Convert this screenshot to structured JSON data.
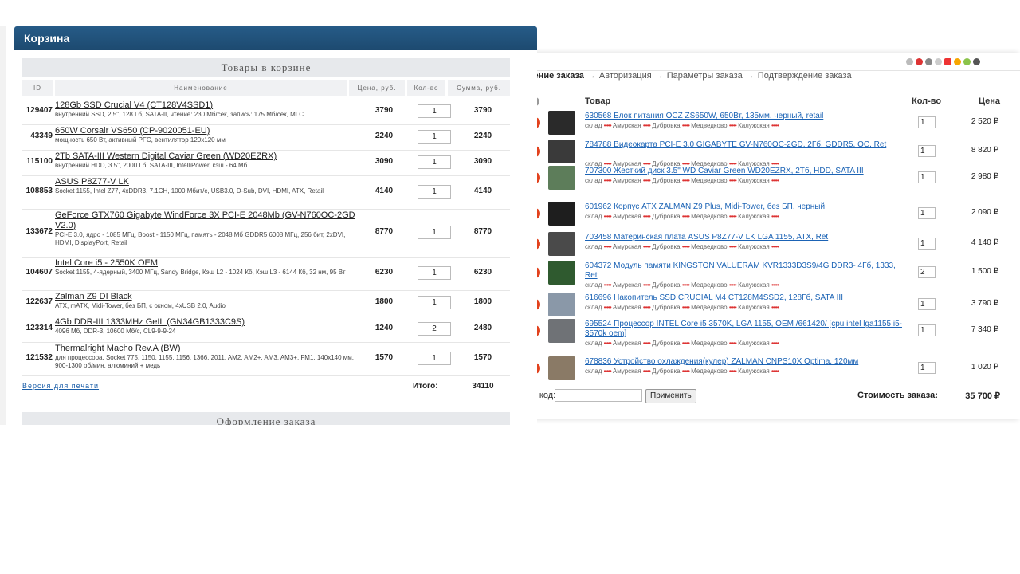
{
  "left_window": {
    "title": "Корзина",
    "section_title": "Товары в корзине",
    "columns": {
      "id": "ID",
      "name": "Наименование",
      "price": "Цена, руб.",
      "qty": "Кол-во",
      "sum": "Сумма, руб."
    },
    "rows": [
      {
        "id": "129407",
        "name": "128Gb SSD Crucial V4 (CT128V4SSD1)",
        "desc": "внутренний SSD, 2.5\", 128 Гб, SATA-II, чтение: 230 Мб/сек, запись: 175 Мб/сек, MLC",
        "price": "3790",
        "qty": "1",
        "sum": "3790"
      },
      {
        "id": "43349",
        "name": "650W Corsair VS650 (CP-9020051-EU)",
        "desc": "мощность 650 Вт, активный PFC, вентилятор 120x120 мм",
        "price": "2240",
        "qty": "1",
        "sum": "2240"
      },
      {
        "id": "115100",
        "name": "2Tb SATA-III Western Digital Caviar Green (WD20EZRX)",
        "desc": "внутренний HDD, 3.5\", 2000 Гб, SATA-III, IntelliPower, кэш - 64 Мб",
        "price": "3090",
        "qty": "1",
        "sum": "3090"
      },
      {
        "id": "108853",
        "name": "ASUS P8Z77-V LK",
        "desc": "Socket 1155, Intel Z77, 4xDDR3, 7.1CH, 1000 Мбит/с, USB3.0, D-Sub, DVI, HDMI, ATX, Retail",
        "price": "4140",
        "qty": "1",
        "sum": "4140"
      },
      {
        "id": "133672",
        "name": "GeForce GTX760 Gigabyte WindForce 3X PCI-E 2048Mb (GV-N760OC-2GD V2.0)",
        "desc": "PCI-E 3.0, ядро - 1085 МГц, Boost - 1150 МГц, память - 2048 Мб GDDR5 6008 МГц, 256 бит, 2xDVI, HDMI, DisplayPort, Retail",
        "price": "8770",
        "qty": "1",
        "sum": "8770"
      },
      {
        "id": "104607",
        "name": "Intel Core i5 - 2550K OEM",
        "desc": "Socket 1155, 4-ядерный, 3400 МГц, Sandy Bridge, Кэш L2 - 1024 Кб, Кэш L3 - 6144 Кб, 32 нм, 95 Вт",
        "price": "6230",
        "qty": "1",
        "sum": "6230"
      },
      {
        "id": "122637",
        "name": "Zalman Z9 DI Black",
        "desc": "ATX, mATX, Midi-Tower, без БП, с окном, 4xUSB 2.0, Audio",
        "price": "1800",
        "qty": "1",
        "sum": "1800"
      },
      {
        "id": "123314",
        "name": "4Gb DDR-III 1333MHz GeIL (GN34GB1333C9S)",
        "desc": "4096 Мб, DDR-3, 10600 Мб/с, CL9-9-9-24",
        "price": "1240",
        "qty": "2",
        "sum": "2480"
      },
      {
        "id": "121532",
        "name": "Thermalright Macho Rev.A (BW)",
        "desc": "для процессора, Socket 775, 1150, 1155, 1156, 1366, 2011, AM2, AM2+, AM3, AM3+, FM1, 140x140 мм, 900-1300 об/мин, алюминий + медь",
        "price": "1570",
        "qty": "1",
        "sum": "1570"
      }
    ],
    "print_link": "Версия для печати",
    "total_label": "Итого:",
    "total_value": "34110",
    "order_section": "Оформление заказа"
  },
  "right_window": {
    "breadcrumbs": [
      "Уточнение заказа",
      "Авторизация",
      "Параметры заказа",
      "Подтверждение заказа"
    ],
    "columns": {
      "product": "Товар",
      "qty": "Кол-во",
      "price": "Цена"
    },
    "stock_labels": {
      "warehouse": "склад",
      "s1": "Амурская",
      "s2": "Дубровка",
      "s3": "Медведково",
      "s4": "Калужская"
    },
    "items": [
      {
        "title": "630568 Блок питания OCZ ZS650W, 650Вт, 135мм, черный, retail",
        "qty": "1",
        "price": "2 520 ₽",
        "thumb_color": "#2a2a2a"
      },
      {
        "title": "784788 Видеокарта PCI-E 3.0 GIGABYTE GV-N760OC-2GD, 2Гб, GDDR5, OC, Ret",
        "qty": "1",
        "price": "8 820 ₽",
        "thumb_color": "#3a3a3a"
      },
      {
        "title": "707300 Жесткий диск 3.5\" WD Caviar Green WD20EZRX, 2Тб, HDD, SATA III",
        "qty": "1",
        "price": "2 980 ₽",
        "thumb_color": "#5d7d5a"
      },
      {
        "title": "601962 Корпус ATX ZALMAN Z9 Plus, Midi-Tower, без БП, черный",
        "qty": "1",
        "price": "2 090 ₽",
        "thumb_color": "#1e1e1e"
      },
      {
        "title": "703458 Материнская плата ASUS P8Z77-V LK LGA 1155, ATX, Ret",
        "qty": "1",
        "price": "4 140 ₽",
        "thumb_color": "#4a4a4a"
      },
      {
        "title": "604372 Модуль памяти KINGSTON VALUERAM KVR1333D3S9/4G DDR3- 4Гб, 1333, Ret",
        "qty": "2",
        "price": "1 500 ₽",
        "thumb_color": "#2f5a2f"
      },
      {
        "title": "616696 Накопитель SSD CRUCIAL M4 CT128M4SSD2, 128Гб, SATA III",
        "qty": "1",
        "price": "3 790 ₽",
        "thumb_color": "#8a98a8"
      },
      {
        "title": "695524 Процессор INTEL Core i5 3570K, LGA 1155, OEM /661420/ [cpu intel lga1155 i5-3570k oem]",
        "qty": "1",
        "price": "7 340 ₽",
        "thumb_color": "#6f7276"
      },
      {
        "title": "678836 Устройство охлаждения(кулер) ZALMAN CNPS10X Optima, 120мм",
        "qty": "1",
        "price": "1 020 ₽",
        "thumb_color": "#8a7a66"
      }
    ],
    "promo_label": "Промо код:",
    "apply_button": "Применить",
    "cost_label": "Стоимость заказа:",
    "cost_value": "35 700 ₽"
  }
}
